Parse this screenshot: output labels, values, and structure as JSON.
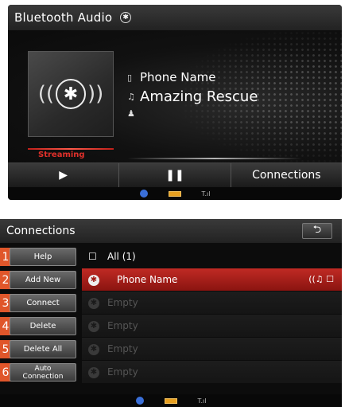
{
  "bluetooth_audio": {
    "title": "Bluetooth Audio",
    "bt_symbol": "✱",
    "album_wave_left": "((",
    "album_wave_right": "))",
    "status": "Streaming",
    "phone_icon": "▯",
    "phone_name": "Phone Name",
    "music_icon": "♫",
    "song_title": "Amazing Rescue",
    "artist_icon": "♟",
    "controls": {
      "play_label": "▶",
      "pause_label": "❚❚",
      "connections_label": "Connections"
    },
    "status_bar": {
      "signal": "T.ıl"
    }
  },
  "connections": {
    "title": "Connections",
    "back_label": "⮌",
    "side_buttons": [
      {
        "num": "1",
        "label": "Help"
      },
      {
        "num": "2",
        "label": "Add New"
      },
      {
        "num": "3",
        "label": "Connect"
      },
      {
        "num": "4",
        "label": "Delete"
      },
      {
        "num": "5",
        "label": "Delete All"
      },
      {
        "num": "6",
        "label": "Auto Connection"
      }
    ],
    "list": {
      "all_label": "All (1)",
      "checkbox": "☐",
      "active_device": "Phone Name",
      "active_icons": "((♫ ☐",
      "empty_label": "Empty"
    },
    "status_bar": {
      "signal": "T.ıl"
    }
  },
  "colors": {
    "accent_red": "#c02a24",
    "number_orange": "#e0562a",
    "battery": "#e8a020",
    "bt_blue": "#3a6fd8"
  }
}
